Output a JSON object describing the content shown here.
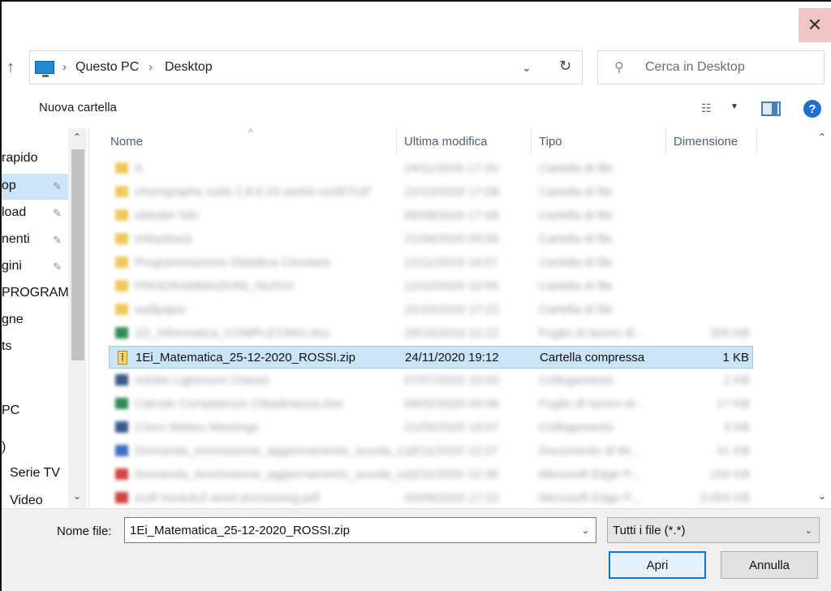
{
  "window": {
    "close_glyph": "✕"
  },
  "address": {
    "up_glyph": "↑",
    "sep_glyph": "›",
    "crumbs": [
      "Questo PC",
      "Desktop"
    ],
    "dropdown_glyph": "⌄",
    "refresh_glyph": "↻"
  },
  "search": {
    "placeholder": "Cerca in Desktop",
    "icon_glyph": "⚲"
  },
  "toolbar": {
    "new_folder": "Nuova cartella",
    "view_glyph": "☷",
    "drop_glyph": "▼",
    "help_glyph": "?"
  },
  "nav": {
    "items": [
      {
        "label": "rapido",
        "pinned": false
      },
      {
        "label": "op",
        "pinned": true,
        "selected": true
      },
      {
        "label": "load",
        "pinned": true
      },
      {
        "label": "nenti",
        "pinned": true
      },
      {
        "label": "gini",
        "pinned": true
      },
      {
        "label": "PROGRAM",
        "pinned": false
      },
      {
        "label": "gne",
        "pinned": false
      },
      {
        "label": "ts",
        "pinned": false
      },
      {
        "label": "",
        "pinned": false
      },
      {
        "label": "PC",
        "pinned": false
      },
      {
        "label": ")",
        "pinned": false
      },
      {
        "label": "Serie TV",
        "pinned": false
      },
      {
        "label": "Video",
        "pinned": false
      }
    ],
    "pin_glyph": "📌",
    "up_glyph": "⌃",
    "down_glyph": "⌄"
  },
  "columns": {
    "name": "Nome",
    "modified": "Ultima modifica",
    "type": "Tipo",
    "size": "Dimensione"
  },
  "files": [
    {
      "name": "A",
      "date": "24/11/2020 17:20",
      "type": "Cartella di file",
      "size": "",
      "icon": "folder-icon",
      "blurred": true
    },
    {
      "name": "choregraphe suite 2.8.6.23 win64 nsSETUP",
      "date": "22/10/2020 17:08",
      "type": "Cartella di file",
      "size": "",
      "icon": "folder-icon",
      "blurred": true
    },
    {
      "name": "eModel Silo",
      "date": "06/08/2020 17:09",
      "type": "Cartella di file",
      "size": "",
      "icon": "folder-icon",
      "blurred": true
    },
    {
      "name": "ImbaStock",
      "date": "21/06/2020 09:56",
      "type": "Cartella di file",
      "size": "",
      "icon": "folder-icon",
      "blurred": true
    },
    {
      "name": "Programmazione Didattica Circolare",
      "date": "12/11/2019 16:07",
      "type": "Cartella di file",
      "size": "",
      "icon": "folder-icon",
      "blurred": true
    },
    {
      "name": "PROGRAMMAZIONI_NUOVI",
      "date": "12/10/2020 10:55",
      "type": "Cartella di file",
      "size": "",
      "icon": "folder-icon",
      "blurred": true
    },
    {
      "name": "wallpaper",
      "date": "22/10/2020 17:22",
      "type": "Cartella di file",
      "size": "",
      "icon": "folder-icon",
      "blurred": true
    },
    {
      "name": "1D_Informatica_COMPLETIMO.xlsx",
      "date": "28/10/2019 12:22",
      "type": "Foglio di lavoro di...",
      "size": "300 KB",
      "icon": "xlsx-icon",
      "blurred": true
    },
    {
      "name": "1Ei_Matematica_25-12-2020_ROSSI.zip",
      "date": "24/11/2020 19:12",
      "type": "Cartella compressa",
      "size": "1 KB",
      "icon": "zip-icon",
      "blurred": false,
      "selected": true
    },
    {
      "name": "Adobe Lightroom Classic",
      "date": "07/07/2020 10:53",
      "type": "Collegamento",
      "size": "2 KB",
      "icon": "shortcut-icon",
      "blurred": true
    },
    {
      "name": "Calcolo Competenze Cittadinanza.xlsx",
      "date": "06/02/2020 09:58",
      "type": "Foglio di lavoro di...",
      "size": "17 KB",
      "icon": "xlsx-icon",
      "blurred": true
    },
    {
      "name": "Cisco Webex Meetings",
      "date": "21/05/2020 16:07",
      "type": "Collegamento",
      "size": "3 KB",
      "icon": "shortcut-icon",
      "blurred": true
    },
    {
      "name": "Domanda_Ammissione_aggiornamento_scuola_s...",
      "date": "16/11/2020 12:27",
      "type": "Documento di Mi...",
      "size": "41 KB",
      "icon": "docx-icon",
      "blurred": true
    },
    {
      "name": "Domanda_Ammissione_aggiornamento_scuola_s...",
      "date": "03/11/2020 12:28",
      "type": "Microsoft Edge P...",
      "size": "150 KB",
      "icon": "pdf-icon",
      "blurred": true
    },
    {
      "name": "ecdl modulo3 word processing.pdf",
      "date": "30/06/2020 17:22",
      "type": "Microsoft Edge P...",
      "size": "3.054 KB",
      "icon": "pdf-icon",
      "blurred": true
    }
  ],
  "file_scroll": {
    "up_glyph": "⌃",
    "down_glyph": "⌄"
  },
  "bottom": {
    "filename_label": "Nome file:",
    "filename_value": "1Ei_Matematica_25-12-2020_ROSSI.zip",
    "filter_value": "Tutti i file (*.*)",
    "drop_glyph": "⌄",
    "open_label": "Apri",
    "cancel_label": "Annulla"
  },
  "colors": {
    "selection": "#cce4f7",
    "accent": "#0078d7",
    "close_hover": "#f0c5c5"
  }
}
